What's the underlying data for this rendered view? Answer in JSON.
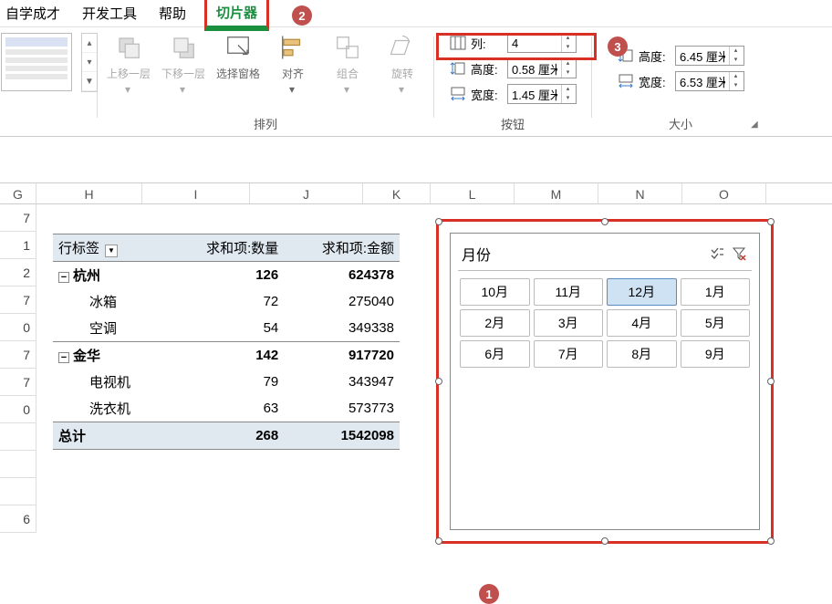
{
  "menu": {
    "items": [
      "自学成才",
      "开发工具",
      "帮助",
      "切片器"
    ],
    "active_index": 3
  },
  "ribbon": {
    "arrange": {
      "label": "排列",
      "up": "上移一层",
      "down": "下移一层",
      "select": "选择窗格",
      "align": "对齐",
      "group": "组合",
      "rotate": "旋转"
    },
    "button": {
      "label": "按钮",
      "columns_label": "列:",
      "columns_value": "4",
      "height_label": "高度:",
      "height_value": "0.58 厘米",
      "width_label": "宽度:",
      "width_value": "1.45 厘米"
    },
    "size": {
      "label": "大小",
      "height_label": "高度:",
      "height_value": "6.45 厘米",
      "width_label": "宽度:",
      "width_value": "6.53 厘米"
    }
  },
  "callouts": {
    "c1": "1",
    "c2": "2",
    "c3": "3"
  },
  "columns": [
    "G",
    "H",
    "I",
    "J",
    "K",
    "L",
    "M",
    "N",
    "O"
  ],
  "row_headers": [
    "7",
    "1",
    "2",
    "7",
    "0",
    "7",
    "7",
    "0",
    "",
    "",
    "",
    "6"
  ],
  "pivot": {
    "headers": [
      "行标签",
      "求和项:数量",
      "求和项:金额"
    ],
    "groups": [
      {
        "name": "杭州",
        "qty": "126",
        "amt": "624378",
        "rows": [
          {
            "name": "冰箱",
            "qty": "72",
            "amt": "275040"
          },
          {
            "name": "空调",
            "qty": "54",
            "amt": "349338"
          }
        ]
      },
      {
        "name": "金华",
        "qty": "142",
        "amt": "917720",
        "rows": [
          {
            "name": "电视机",
            "qty": "79",
            "amt": "343947"
          },
          {
            "name": "洗衣机",
            "qty": "63",
            "amt": "573773"
          }
        ]
      }
    ],
    "total": {
      "name": "总计",
      "qty": "268",
      "amt": "1542098"
    }
  },
  "slicer": {
    "title": "月份",
    "items": [
      "10月",
      "11月",
      "12月",
      "1月",
      "2月",
      "3月",
      "4月",
      "5月",
      "6月",
      "7月",
      "8月",
      "9月"
    ],
    "selected_index": 2
  }
}
